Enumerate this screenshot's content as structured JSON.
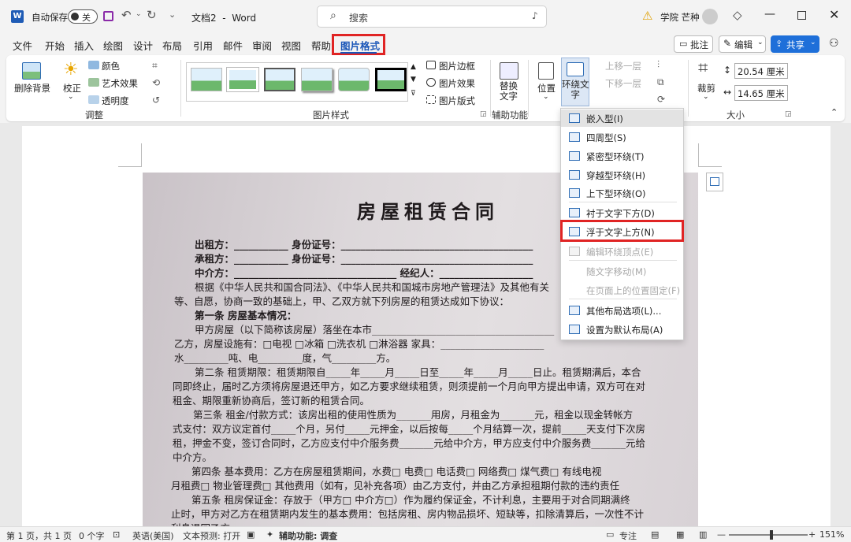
{
  "titlebar": {
    "autosave_label": "自动保存",
    "autosave_state": "关",
    "doc_title": "文档2  -  Word",
    "search_placeholder": "搜索",
    "user_name": "学院 芒种"
  },
  "tabs": [
    "文件",
    "开始",
    "插入",
    "绘图",
    "设计",
    "布局",
    "引用",
    "邮件",
    "审阅",
    "视图",
    "帮助",
    "图片格式"
  ],
  "header_buttons": {
    "comment": "批注",
    "edit": "编辑",
    "share": "共享"
  },
  "ribbon": {
    "remove_bg": "删除背景",
    "correct": "校正",
    "color": "颜色",
    "art_effect": "艺术效果",
    "transparency": "透明度",
    "group_adjust": "调整",
    "group_style": "图片样式",
    "border": "图片边框",
    "effect": "图片效果",
    "layout": "图片版式",
    "alt_text": "替换\n文字",
    "group_access": "辅助功能",
    "position": "位置",
    "wrap_text": "环绕文\n字",
    "bring_forward": "上移一层",
    "send_backward": "下移一层",
    "selection_pane": "选择窗格",
    "crop": "裁剪",
    "height": "20.54 厘米",
    "width": "14.65 厘米",
    "group_size": "大小"
  },
  "wrap_menu": {
    "items": [
      {
        "label": "嵌入型(I)",
        "disabled": false
      },
      {
        "label": "四周型(S)",
        "disabled": false
      },
      {
        "label": "紧密型环绕(T)",
        "disabled": false
      },
      {
        "label": "穿越型环绕(H)",
        "disabled": false
      },
      {
        "label": "上下型环绕(O)",
        "disabled": false
      },
      {
        "label": "衬于文字下方(D)",
        "disabled": false
      },
      {
        "label": "浮于文字上方(N)",
        "disabled": false
      },
      {
        "label": "编辑环绕顶点(E)",
        "disabled": true
      },
      {
        "label": "随文字移动(M)",
        "disabled": true
      },
      {
        "label": "在页面上的位置固定(F)",
        "disabled": true
      },
      {
        "label": "其他布局选项(L)...",
        "disabled": false
      },
      {
        "label": "设置为默认布局(A)",
        "disabled": false
      }
    ]
  },
  "document": {
    "title": "房屋租赁合同",
    "lines": [
      "出租方：___________          身份证号：_______________________________________",
      "承租方：___________          身份证号：_______________________________________",
      "中介方：_________________________________          经纪人：___________________",
      "根据《中华人民共和国合同法》、《中华人民共和国城市房地产管理法》及其他有关",
      "等、自愿，协商一致的基础上，甲、乙双方就下列房屋的租赁达成如下协议：",
      "第一条   房屋基本情况：",
      "甲方房屋（以下简称该房屋）落坐在本市_____________________________________",
      "乙方，房屋设施有：□电视  □冰箱  □洗衣机  □淋浴器   家具：_____________________",
      "水_________吨、电_________度，气_________方。",
      "第二条   租赁期限：租赁期限自_____年_____月_____日至_____年_____月_____日止。租赁期满后，本合",
      "同即终止，届时乙方须将房屋退还甲方，如乙方要求继续租赁，则须提前一个月向甲方提出申请，双方可在对",
      "租金、期限重新协商后，签订新的租赁合同。",
      "第三条   租金/付款方式：该房出租的使用性质为_______用房，月租金为_______元，租金以现金转帐方",
      "式支付：双方议定首付_____个月，另付_____元押金，以后按每_____个月结算一次，提前_____天支付下次房",
      "租，押金不变，签订合同时，乙方应支付中介服务费_______元给中介方，甲方应支付中介服务费_______元给",
      "中介方。",
      "第四条   基本费用：乙方在房屋租赁期间，水费□   电费□   电话费□   网络费□   煤气费□   有线电视",
      "月租费□   物业管理费□   其他费用（如有，见补充各项）由乙方支付，并由乙方承担租期付款的违约责任",
      "第五条   租房保证金：存放于（甲方□   中介方□）作为履约保证金，不计利息，主要用于对合同期满终",
      "止时，甲方对乙方在租赁期内发生的基本费用：包括房租、房内物品损坏、短缺等，扣除清算后，一次性不计",
      "利息退回乙方。"
    ]
  },
  "status": {
    "page": "第 1 页，共 1 页",
    "words": "0 个字",
    "lang": "英语(美国)",
    "predict": "文本预测: 打开",
    "access": "辅助功能: 调查",
    "focus": "专注",
    "zoom": "151%"
  },
  "colors": {
    "accent": "#1a56b8",
    "highlight": "#e02424",
    "share": "#1e6fd9"
  }
}
